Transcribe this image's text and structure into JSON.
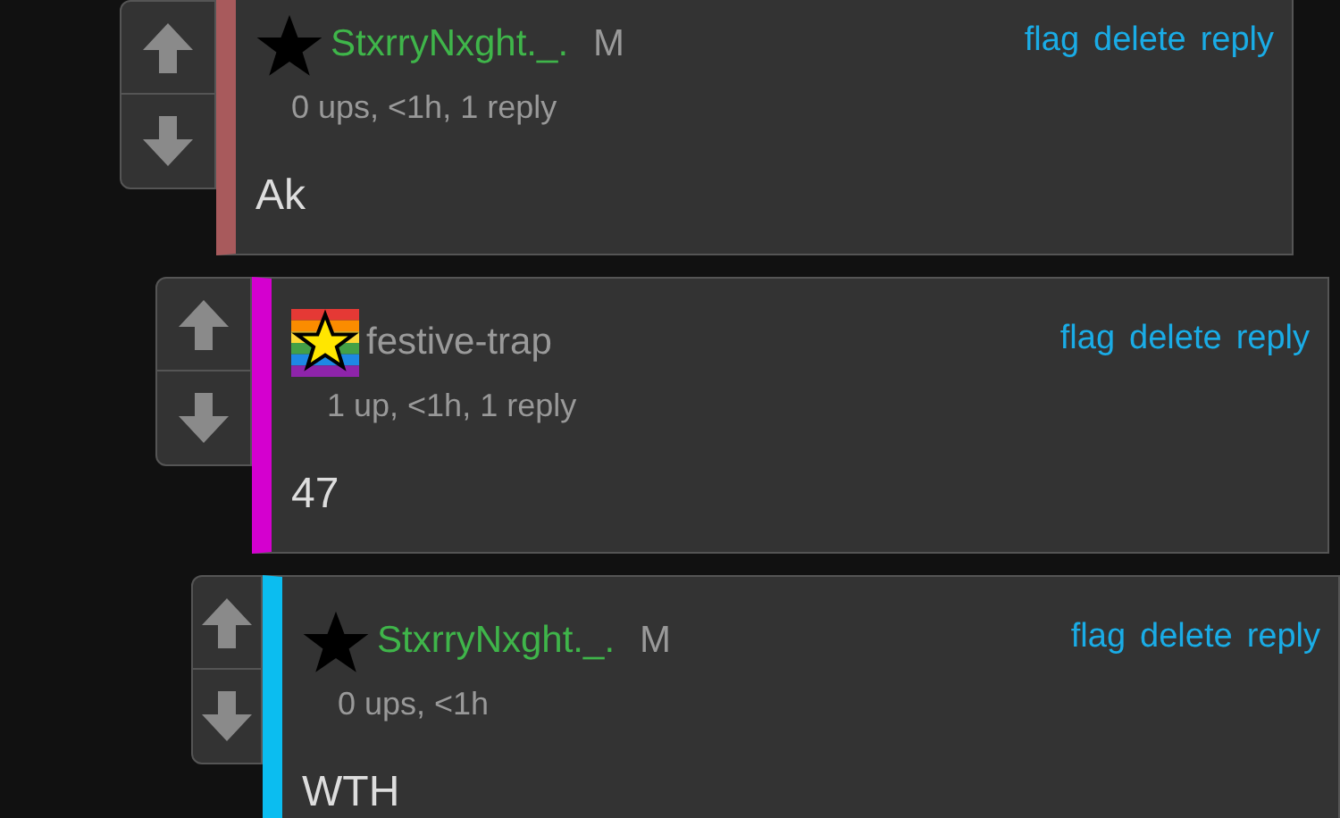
{
  "comments": [
    {
      "badge": {
        "kind": "star"
      },
      "user": {
        "name": "StxrryNxght._.",
        "color": "#3fb54a"
      },
      "mod_tag": "M",
      "color": "#a85a5c",
      "meta": "0 ups, <1h, 1 reply",
      "body": "Ak",
      "actions": [
        "flag",
        "delete",
        "reply"
      ],
      "children": [
        {
          "badge": {
            "kind": "rainbow-star"
          },
          "user": {
            "name": "festive-trap",
            "color": "#9a9a9a"
          },
          "color": "#d400cf",
          "meta": "1 up, <1h, 1 reply",
          "body": "47",
          "actions": [
            "flag",
            "delete",
            "reply"
          ],
          "children": [
            {
              "badge": {
                "kind": "star"
              },
              "user": {
                "name": "StxrryNxght._.",
                "color": "#3fb54a"
              },
              "mod_tag": "M",
              "color": "#0bbdf0",
              "meta": "0 ups, <1h",
              "body": "WTH",
              "actions": [
                "flag",
                "delete",
                "reply"
              ]
            }
          ]
        }
      ]
    }
  ]
}
